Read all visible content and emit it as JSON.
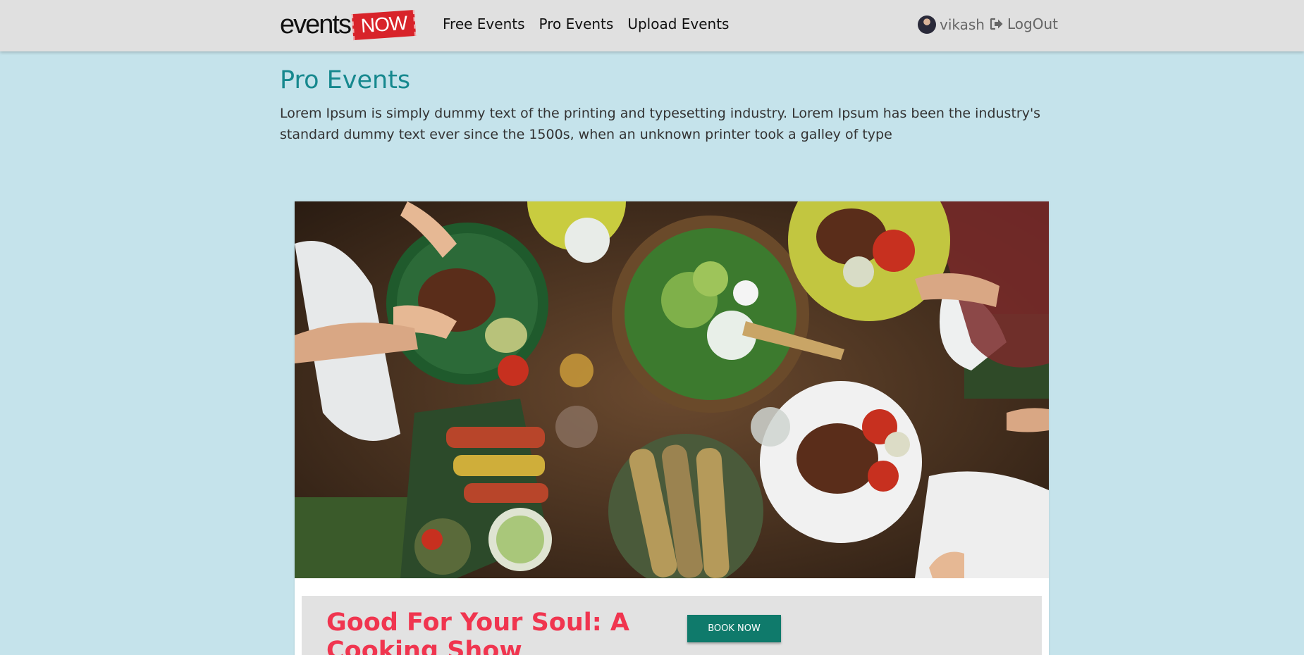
{
  "brand": {
    "word": "events",
    "badge": "NOW"
  },
  "nav": {
    "links": [
      "Free Events",
      "Pro Events",
      "Upload Events"
    ]
  },
  "user": {
    "name": "vikash",
    "logout_label": "LogOut"
  },
  "page": {
    "title": "Pro Events",
    "description": "Lorem Ipsum is simply dummy text of the printing and typesetting industry. Lorem Ipsum has been the industry's standard dummy text ever since the 1500s, when an unknown printer took a galley of type"
  },
  "event": {
    "title": "Good For Your Soul: A Cooking Show",
    "book_label": "BOOK NOW",
    "image_alt": "Overhead view of a dinner table with steaks, salad and grilled corn"
  },
  "colors": {
    "accent": "#16888e",
    "event_title": "#f0354f",
    "button": "#0f7a6b",
    "page_bg": "#c5e3eb",
    "navbar_bg": "#e0e0e0"
  }
}
